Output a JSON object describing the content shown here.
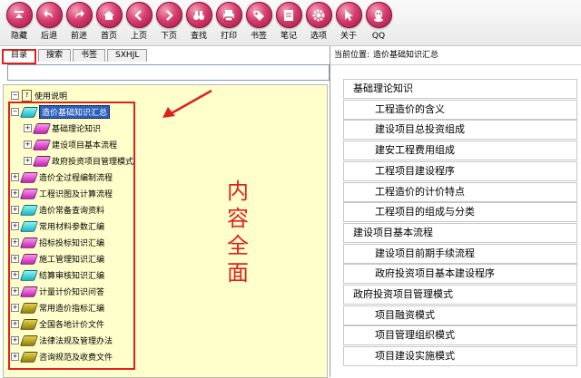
{
  "toolbar": {
    "buttons": [
      {
        "label": "隐藏",
        "icon": "arrow-down-bar-icon"
      },
      {
        "label": "后退",
        "icon": "back-arrow-icon"
      },
      {
        "label": "前进",
        "icon": "forward-arrow-icon"
      },
      {
        "label": "首页",
        "icon": "home-icon"
      },
      {
        "label": "上页",
        "icon": "chevron-left-icon"
      },
      {
        "label": "下页",
        "icon": "chevron-right-icon"
      },
      {
        "label": "查找",
        "icon": "binoculars-icon"
      },
      {
        "label": "打印",
        "icon": "printer-icon"
      },
      {
        "label": "书签",
        "icon": "tag-icon"
      },
      {
        "label": "笔记",
        "icon": "notepad-icon"
      },
      {
        "label": "选项",
        "icon": "gear-icon"
      },
      {
        "label": "关于",
        "icon": "pointer-icon"
      },
      {
        "label": "QQ",
        "icon": "qq-icon"
      }
    ]
  },
  "left_panel": {
    "tabs": [
      {
        "label": "目录",
        "active": true
      },
      {
        "label": "搜索",
        "active": false
      },
      {
        "label": "书签",
        "active": false
      },
      {
        "label": "SXHJL",
        "active": false
      }
    ],
    "search_value": "",
    "tree": {
      "root": "使用说明",
      "items": [
        {
          "label": "造价基础知识汇总",
          "level": 1,
          "expander": "−",
          "book": "cyan",
          "selected": true
        },
        {
          "label": "基础理论知识",
          "level": 2,
          "expander": "+",
          "book": "pink"
        },
        {
          "label": "建设项目基本流程",
          "level": 2,
          "expander": "+",
          "book": "pink"
        },
        {
          "label": "政府投资项目管理模式",
          "level": 2,
          "expander": "+",
          "book": "pink"
        },
        {
          "label": "造价全过程编制流程",
          "level": 1,
          "expander": "+",
          "book": "pink"
        },
        {
          "label": "工程识图及计算流程",
          "level": 1,
          "expander": "+",
          "book": "pink"
        },
        {
          "label": "造价常备查询资料",
          "level": 1,
          "expander": "+",
          "book": "cyan"
        },
        {
          "label": "常用材料参数汇编",
          "level": 1,
          "expander": "+",
          "book": "cyan"
        },
        {
          "label": "招标投标知识汇编",
          "level": 1,
          "expander": "+",
          "book": "pink"
        },
        {
          "label": "施工管理知识汇编",
          "level": 1,
          "expander": "+",
          "book": "pink"
        },
        {
          "label": "结算审核知识汇编",
          "level": 1,
          "expander": "+",
          "book": "cyan"
        },
        {
          "label": "计量计价知识问答",
          "level": 1,
          "expander": "+",
          "book": "pink"
        },
        {
          "label": "常用造价指标汇编",
          "level": 1,
          "expander": "+",
          "book": "olive"
        },
        {
          "label": "全国各地计价文件",
          "level": 1,
          "expander": "+",
          "book": "olive"
        },
        {
          "label": "法律法规及管理办法",
          "level": 1,
          "expander": "+",
          "book": "olive"
        },
        {
          "label": "咨询规范及收费文件",
          "level": 1,
          "expander": "+",
          "book": "olive"
        }
      ]
    },
    "annotation": [
      "内",
      "容",
      "全",
      "面"
    ]
  },
  "right_panel": {
    "location_prefix": "当前位置:",
    "location_value": "造价基础知识汇总",
    "rows": [
      {
        "text": "基础理论知识",
        "indent": 1
      },
      {
        "text": "工程造价的含义",
        "indent": 2
      },
      {
        "text": "建设项目总投资组成",
        "indent": 2
      },
      {
        "text": "建安工程费用组成",
        "indent": 2
      },
      {
        "text": "工程项目建设程序",
        "indent": 2
      },
      {
        "text": "工程造价的计价特点",
        "indent": 2
      },
      {
        "text": "工程项目的组成与分类",
        "indent": 2
      },
      {
        "text": "建设项目基本流程",
        "indent": 1
      },
      {
        "text": "建设项目前期手续流程",
        "indent": 2
      },
      {
        "text": "政府投资项目基本建设程序",
        "indent": 2
      },
      {
        "text": "政府投资项目管理模式",
        "indent": 1
      },
      {
        "text": "项目融资模式",
        "indent": 2
      },
      {
        "text": "项目管理组织模式",
        "indent": 2
      },
      {
        "text": "项目建设实施模式",
        "indent": 2
      }
    ]
  },
  "colors": {
    "accent_red": "#e0201e",
    "toolbar_icon": "#d63f6e",
    "tree_bg": "#ffffcc",
    "selection": "#2b5fbd"
  }
}
